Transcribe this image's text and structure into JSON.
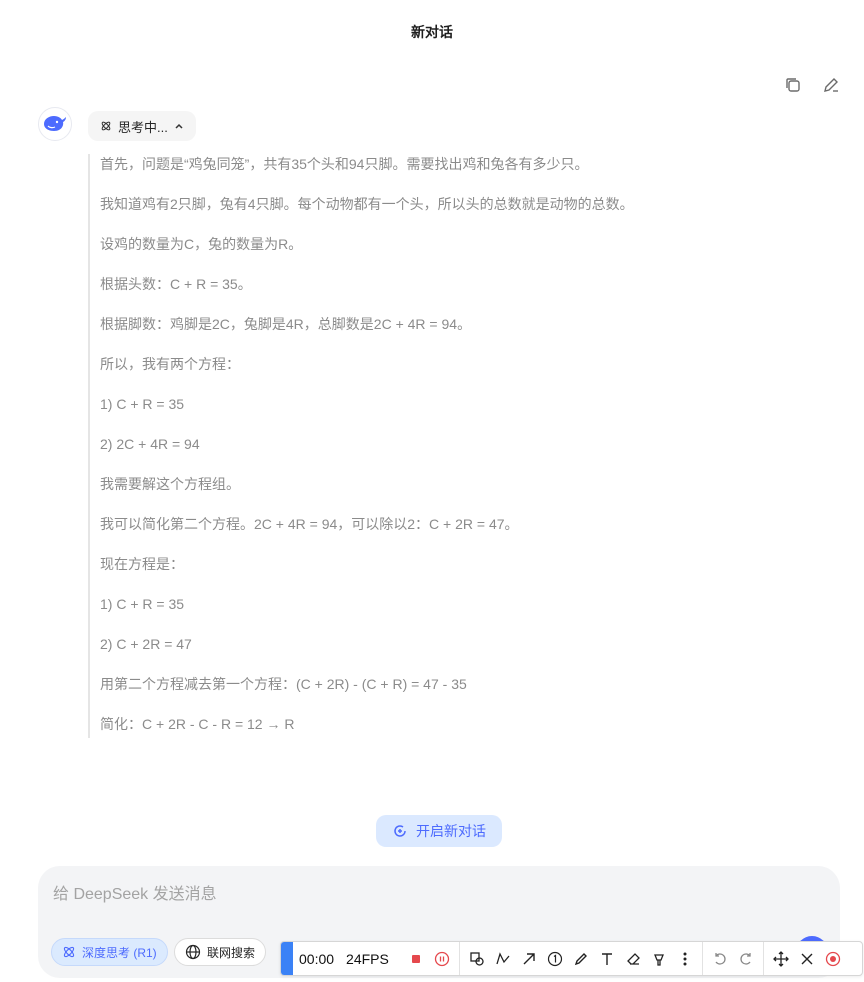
{
  "header": {
    "title": "新对话"
  },
  "message": {
    "thinking_label": "思考中..."
  },
  "thinking_lines": [
    "首先，问题是“鸡兔同笼”，共有35个头和94只脚。需要找出鸡和兔各有多少只。",
    "我知道鸡有2只脚，兔有4只脚。每个动物都有一个头，所以头的总数就是动物的总数。",
    "设鸡的数量为C，兔的数量为R。",
    "根据头数：C + R = 35。",
    "根据脚数：鸡脚是2C，兔脚是4R，总脚数是2C + 4R = 94。",
    "所以，我有两个方程：",
    "1) C + R = 35",
    "2) 2C + 4R = 94",
    "我需要解这个方程组。",
    "我可以简化第二个方程。2C + 4R = 94，可以除以2：C + 2R = 47。",
    "现在方程是：",
    "1) C + R = 35",
    "2) C + 2R = 47",
    "用第二个方程减去第一个方程：(C + 2R) - (C + R) = 47 - 35",
    "简化：C + 2R - C - R = 12 → R"
  ],
  "new_chat_button": "开启新对话",
  "composer": {
    "placeholder": "给 DeepSeek 发送消息",
    "deep_think_label": "深度思考 (R1)",
    "web_search_label": "联网搜索"
  },
  "recorder": {
    "time": "00:00",
    "fps": "24FPS"
  },
  "colors": {
    "accent": "#4d6bfe",
    "recorder_handle": "#3b82f6",
    "record_red": "#e5484d"
  }
}
